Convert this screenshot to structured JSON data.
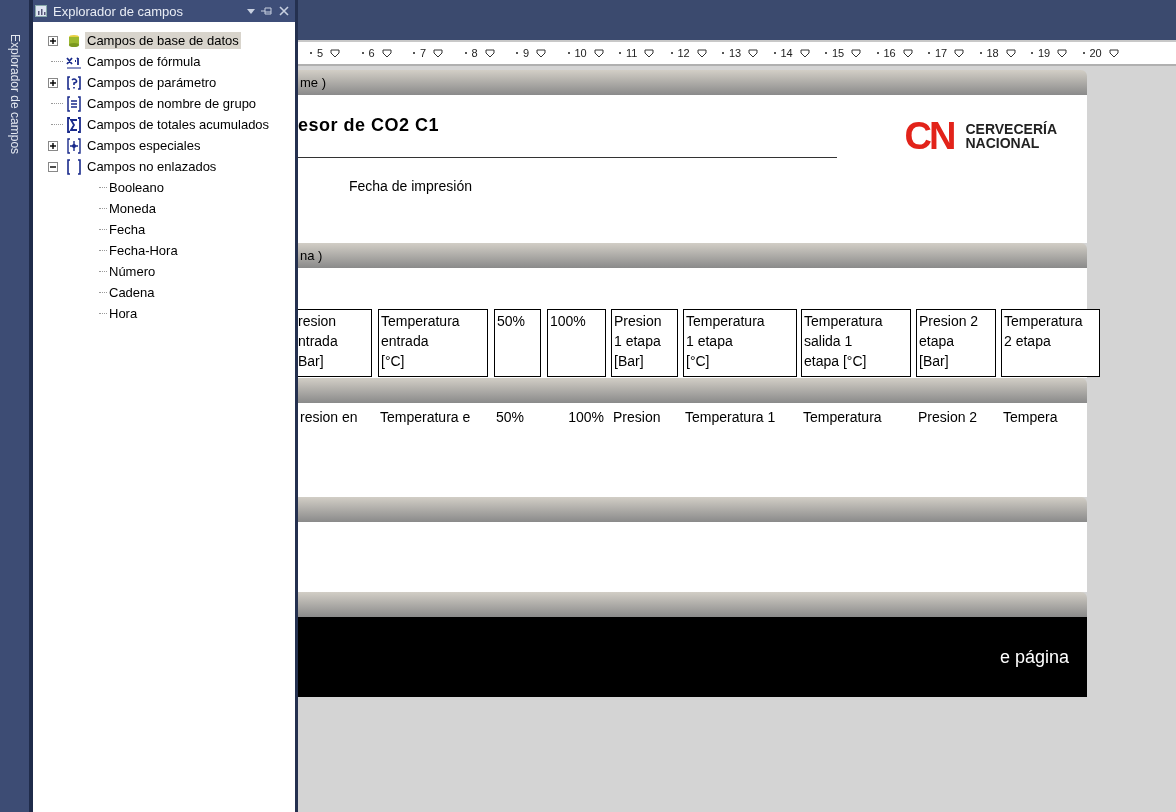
{
  "side_tab": {
    "label": "Explorador de campos"
  },
  "panel": {
    "title": "Explorador de campos",
    "tree": [
      {
        "label": "Campos de base de datos",
        "kind": "database",
        "expandable": true,
        "expanded": false,
        "selected": true
      },
      {
        "label": "Campos de fórmula",
        "kind": "formula",
        "expandable": false,
        "selected": false
      },
      {
        "label": "Campos de parámetro",
        "kind": "parameter",
        "expandable": true,
        "expanded": false,
        "selected": false
      },
      {
        "label": "Campos de nombre de grupo",
        "kind": "group",
        "expandable": false,
        "selected": false
      },
      {
        "label": "Campos de totales acumulados",
        "kind": "sum",
        "expandable": false,
        "selected": false
      },
      {
        "label": "Campos especiales",
        "kind": "special",
        "expandable": true,
        "expanded": false,
        "selected": false
      },
      {
        "label": "Campos no enlazados",
        "kind": "unbound",
        "expandable": true,
        "expanded": true,
        "selected": false,
        "children": [
          {
            "label": "Booleano"
          },
          {
            "label": "Moneda"
          },
          {
            "label": "Fecha"
          },
          {
            "label": "Fecha-Hora"
          },
          {
            "label": "Número"
          },
          {
            "label": "Cadena"
          },
          {
            "label": "Hora"
          }
        ]
      }
    ]
  },
  "ruler": {
    "numbers": [
      "5",
      "6",
      "7",
      "8",
      "9",
      "10",
      "11",
      "12",
      "13",
      "14",
      "15",
      "16",
      "17",
      "18",
      "19",
      "20"
    ]
  },
  "report": {
    "page_header_band": "me )",
    "title": "esor de CO2 C1",
    "logo": {
      "mark": "CN",
      "line_1": "CERVECERÍA",
      "line_2": "NACIONAL"
    },
    "print_date_label": "Fecha de impresión",
    "group_band": "na )",
    "column_headers": [
      "resion\nntrada\nBar]",
      "Temperatura\nentrada\n[°C]",
      "50%",
      "100%",
      "Presion\n1 etapa\n[Bar]",
      "Temperatura\n1 etapa\n[°C]",
      "Temperatura\nsalida 1\netapa [°C]",
      "Presion 2\netapa\n[Bar]",
      "Temperatura\n2 etapa"
    ],
    "detail_fields": [
      "resion en",
      "Temperatura e",
      "50%",
      "100%",
      "Presion",
      "Temperatura 1",
      "Temperatura",
      "Presion 2",
      "Tempera"
    ],
    "footer_text": "e página"
  }
}
